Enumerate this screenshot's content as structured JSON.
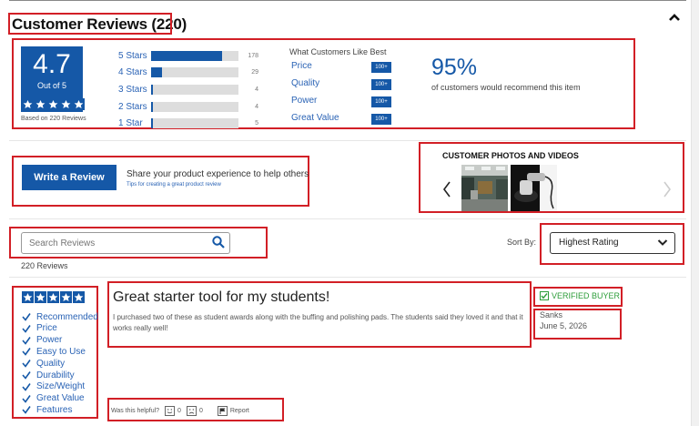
{
  "section": {
    "title": "Customer Reviews (220)"
  },
  "summary": {
    "average": "4.7",
    "out_of": "Out of 5",
    "based_on": "Based on 220 Reviews",
    "distribution": [
      {
        "label": "5 Stars",
        "count": "178",
        "fraction": 0.81
      },
      {
        "label": "4 Stars",
        "count": "29",
        "fraction": 0.13
      },
      {
        "label": "3 Stars",
        "count": "4",
        "fraction": 0.02
      },
      {
        "label": "2 Stars",
        "count": "4",
        "fraction": 0.02
      },
      {
        "label": "1 Star",
        "count": "5",
        "fraction": 0.02
      }
    ],
    "likes_title": "What Customers Like Best",
    "likes": [
      {
        "label": "Price",
        "badge": "100+"
      },
      {
        "label": "Quality",
        "badge": "100+"
      },
      {
        "label": "Power",
        "badge": "100+"
      },
      {
        "label": "Great Value",
        "badge": "100+"
      }
    ],
    "recommend_pct": "95%",
    "recommend_text": "of customers would recommend this item"
  },
  "write": {
    "button": "Write a Review",
    "share": "Share your product experience to help others",
    "tips": "Tips for creating a great product review"
  },
  "photos": {
    "title": "CUSTOMER PHOTOS AND VIDEOS"
  },
  "search": {
    "placeholder": "Search Reviews",
    "count": "220 Reviews"
  },
  "sort": {
    "label": "Sort By:",
    "selected": "Highest Rating"
  },
  "review": {
    "features": [
      "Recommended",
      "Price",
      "Power",
      "Easy to Use",
      "Quality",
      "Durability",
      "Size/Weight",
      "Great Value",
      "Features"
    ],
    "title": "Great starter tool for my students!",
    "body": "I purchased two of these as student awards along with the buffing and polishing pads. The students said they loved it and that it works really well!",
    "verified": "VERIFIED BUYER",
    "author": "Sanks",
    "date": "June 5, 2026",
    "helpful_label": "Was this helpful?",
    "up_count": "0",
    "down_count": "0",
    "report": "Report"
  },
  "colors": {
    "brand": "#1558a7",
    "verified": "#2d9d3a",
    "highlight": "#d21f26"
  }
}
